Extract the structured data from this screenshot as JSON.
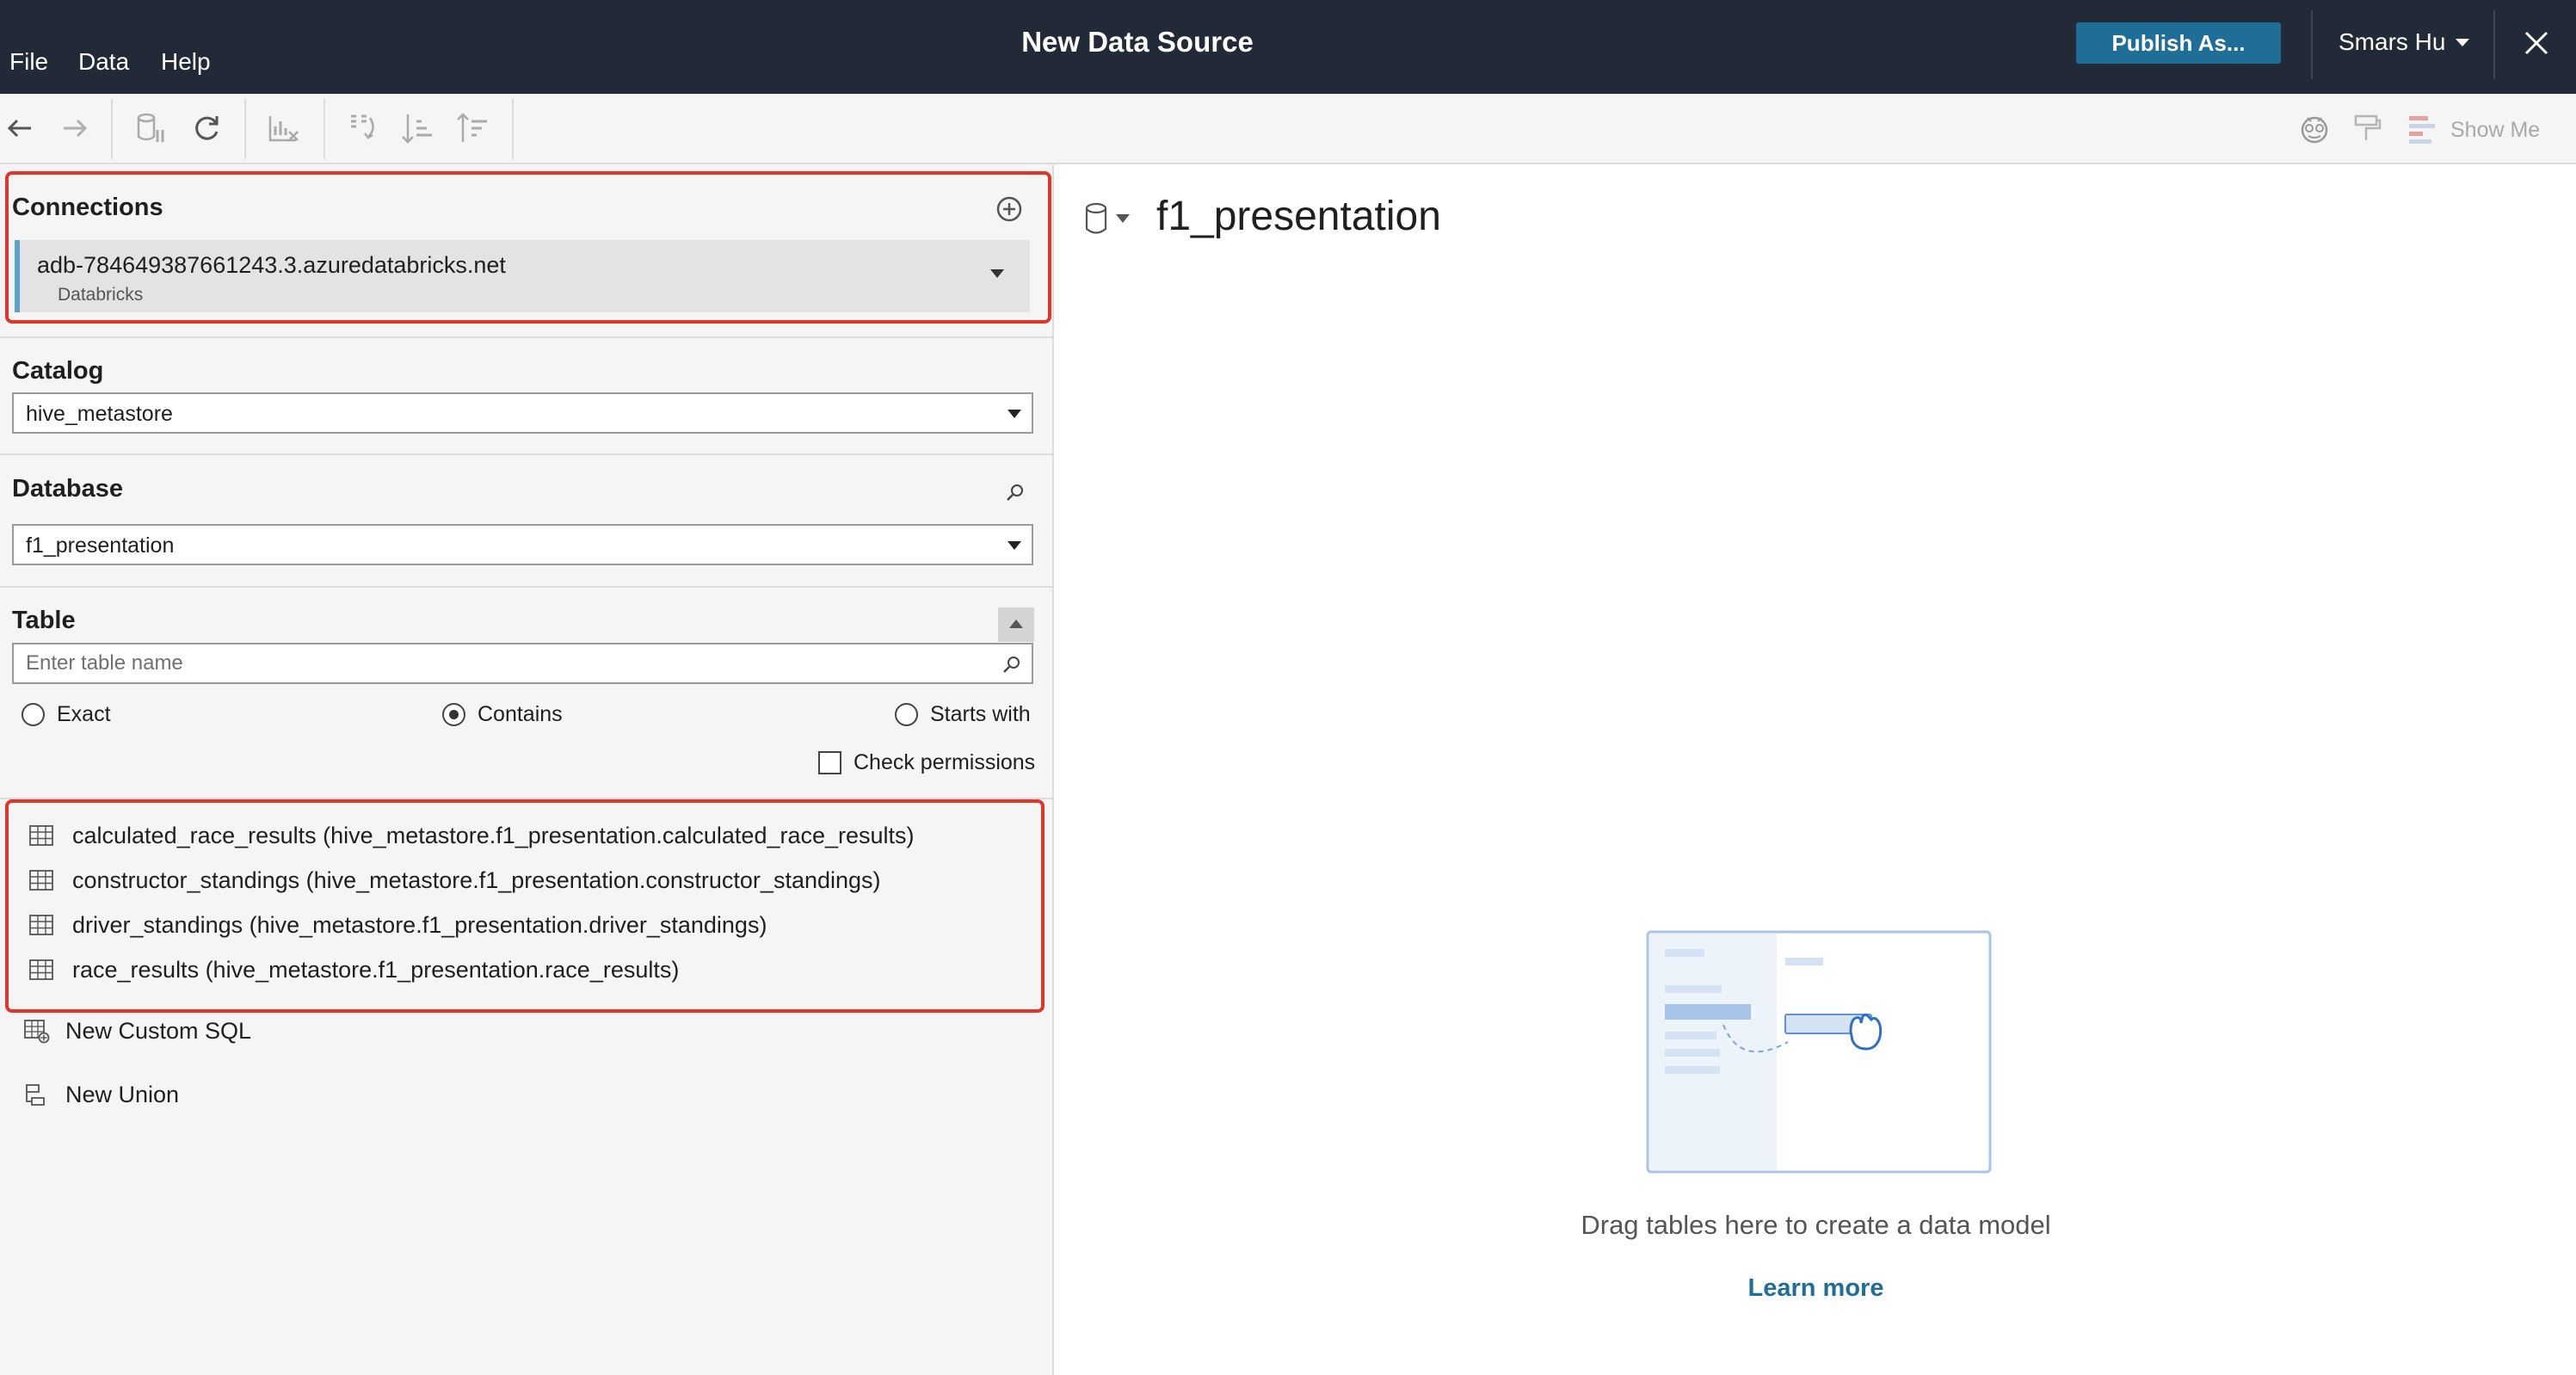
{
  "menu": {
    "file": "File",
    "data": "Data",
    "help": "Help"
  },
  "app_title": "New Data Source",
  "publish_label": "Publish As...",
  "user_name": "Smars Hu",
  "toolbar": {
    "show_me_label": "Show Me"
  },
  "connections": {
    "title": "Connections",
    "items": [
      {
        "host": "adb-784649387661243.3.azuredatabricks.net",
        "type": "Databricks"
      }
    ]
  },
  "catalog": {
    "title": "Catalog",
    "value": "hive_metastore"
  },
  "database": {
    "title": "Database",
    "value": "f1_presentation"
  },
  "table": {
    "title": "Table",
    "search_placeholder": "Enter table name",
    "match_options": [
      {
        "label": "Exact",
        "selected": false
      },
      {
        "label": "Contains",
        "selected": true
      },
      {
        "label": "Starts with",
        "selected": false
      }
    ],
    "check_permissions_label": "Check permissions",
    "check_permissions_checked": false,
    "items": [
      "calculated_race_results (hive_metastore.f1_presentation.calculated_race_results)",
      "constructor_standings (hive_metastore.f1_presentation.constructor_standings)",
      "driver_standings (hive_metastore.f1_presentation.driver_standings)",
      "race_results (hive_metastore.f1_presentation.race_results)"
    ],
    "new_custom_sql": "New Custom SQL",
    "new_union": "New Union"
  },
  "canvas": {
    "datasource_name": "f1_presentation",
    "drag_hint": "Drag tables here to create a data model",
    "learn_more": "Learn more"
  },
  "colors": {
    "topbar": "#222a37",
    "publish": "#1f6e97",
    "highlight": "#e0362a",
    "connection_accent": "#5aa1d0",
    "link": "#1f6e97"
  }
}
